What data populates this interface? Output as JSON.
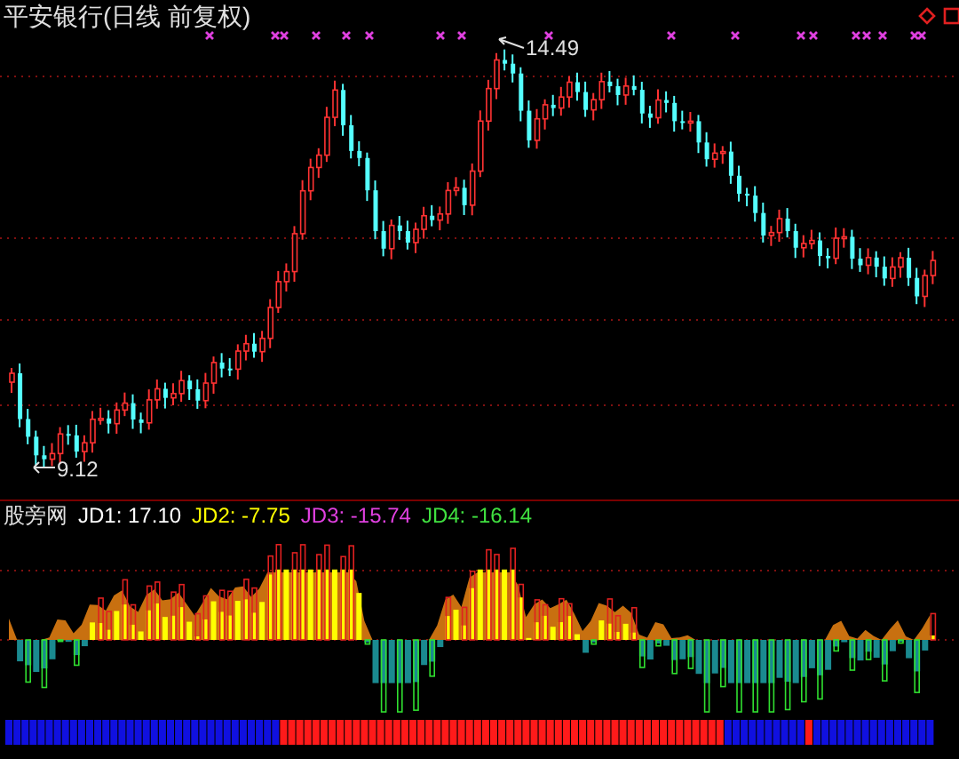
{
  "title": "平安银行(日线 前复权)",
  "price_chart": {
    "high_label": "14.49",
    "low_label": "9.12"
  },
  "indicator": {
    "name": "股旁网",
    "readouts": [
      {
        "label": "JD1:",
        "value": "17.10",
        "color": "#ffffff"
      },
      {
        "label": "JD2:",
        "value": "-7.75",
        "color": "#ffff00"
      },
      {
        "label": "JD3:",
        "value": "-15.74",
        "color": "#e040e0"
      },
      {
        "label": "JD4:",
        "value": "-16.14",
        "color": "#40e040"
      }
    ]
  }
}
